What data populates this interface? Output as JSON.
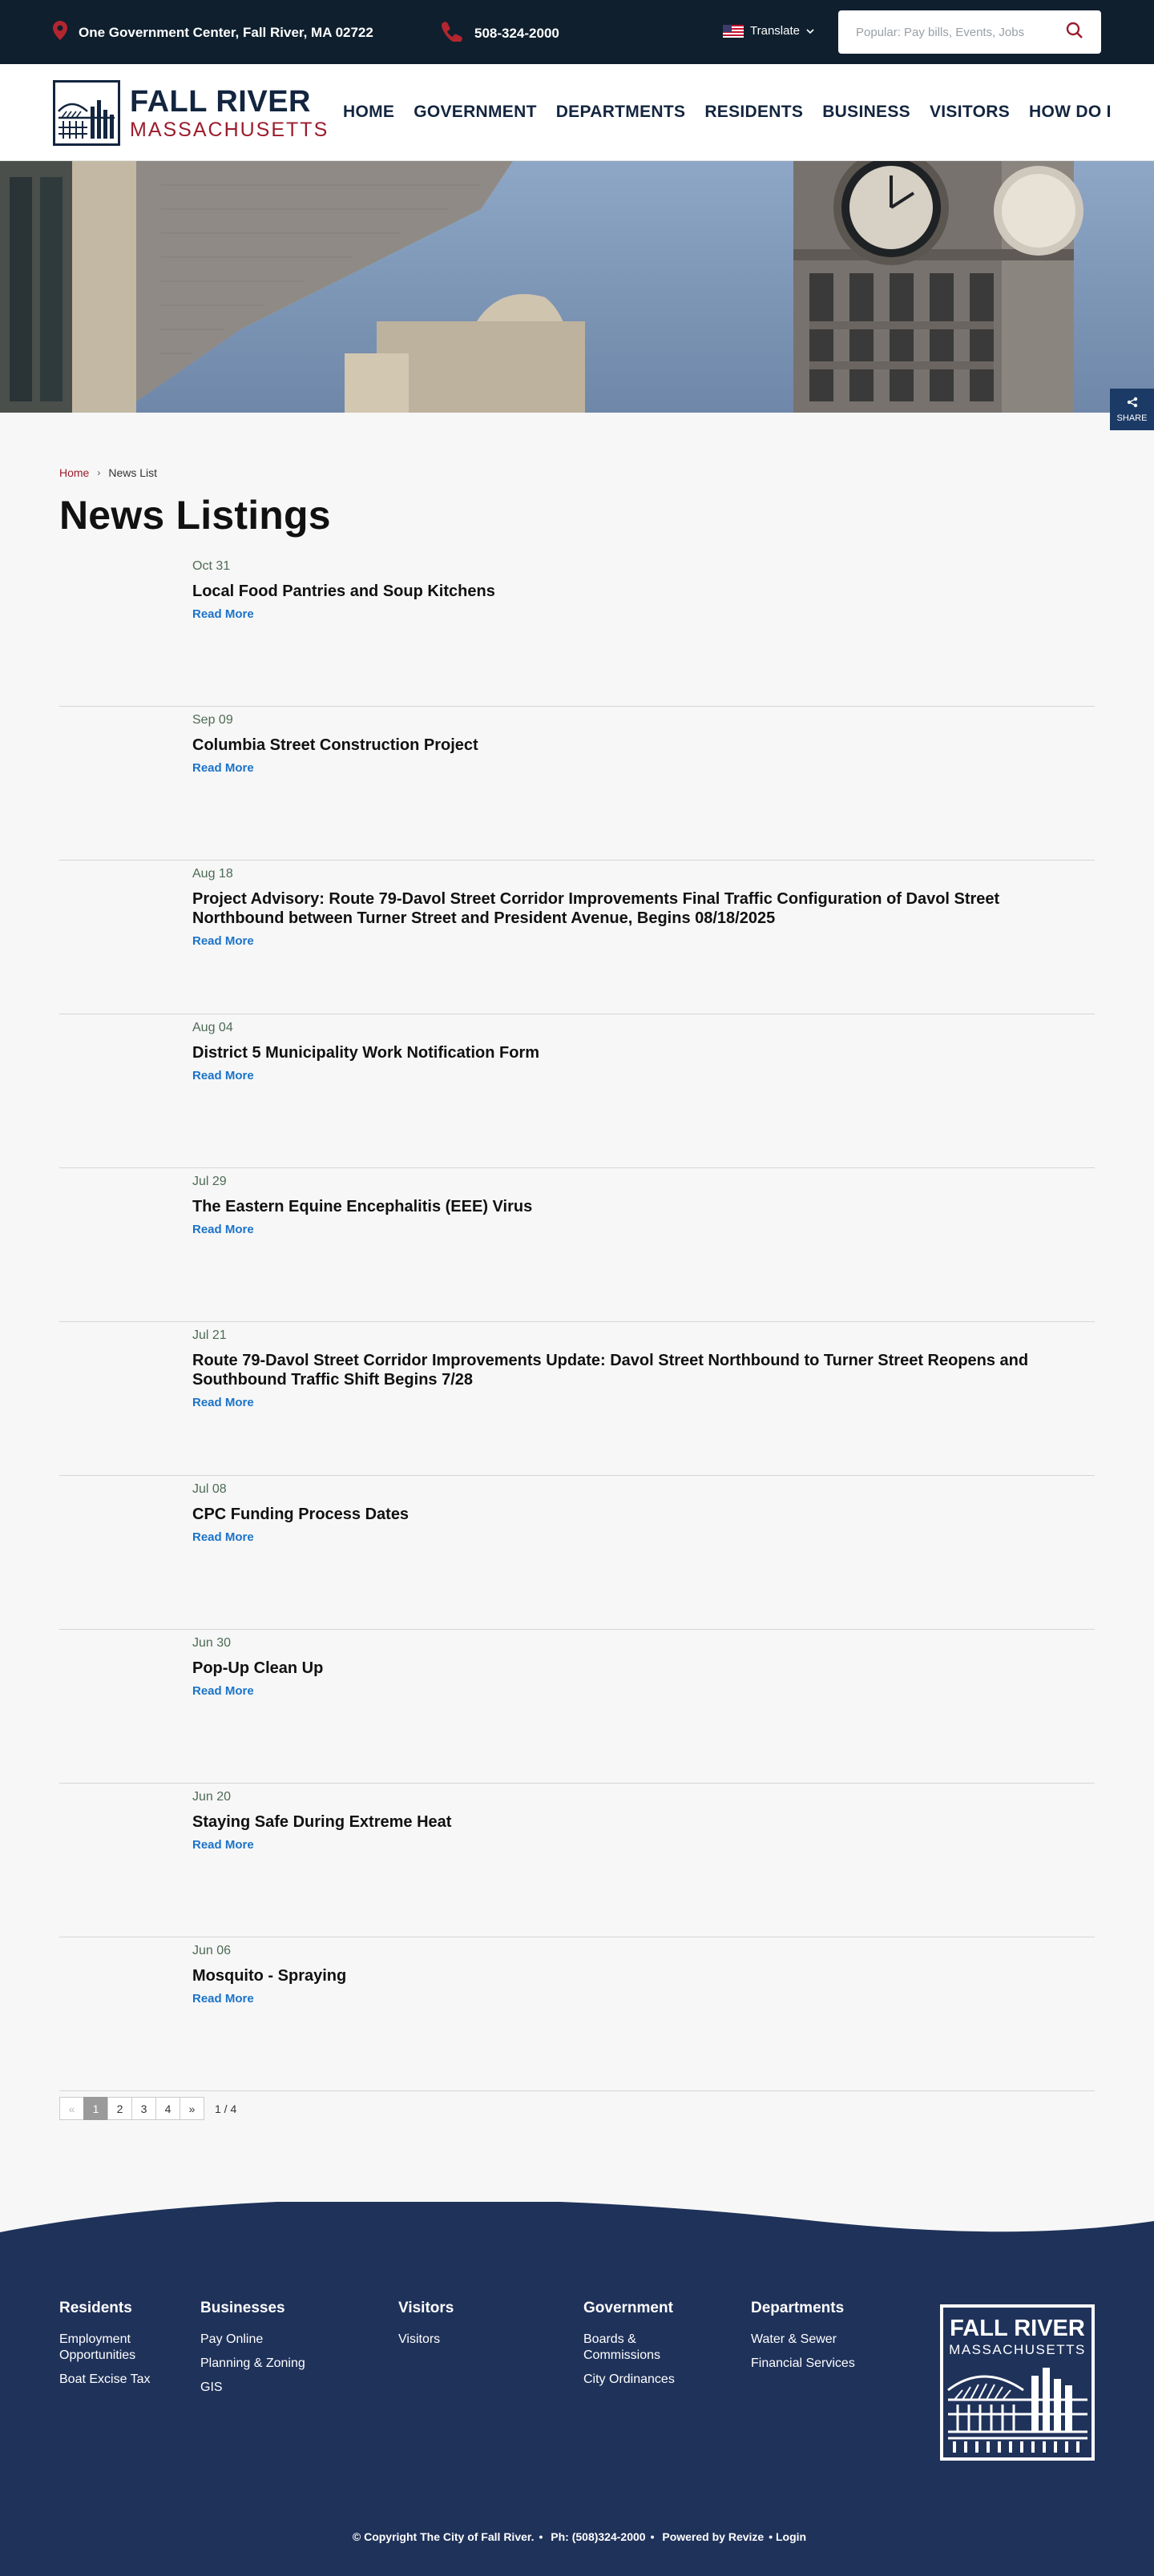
{
  "topbar": {
    "address": "One Government Center, Fall River, MA 02722",
    "phone": "508-324-2000",
    "translate_label": "Translate",
    "search_placeholder": "Popular: Pay bills, Events, Jobs"
  },
  "header": {
    "logo_line1": "FALL RIVER",
    "logo_line2": "MASSACHUSETTS",
    "nav": [
      "HOME",
      "GOVERNMENT",
      "DEPARTMENTS",
      "RESIDENTS",
      "BUSINESS",
      "VISITORS",
      "HOW DO I"
    ]
  },
  "share_label": "SHARE",
  "breadcrumb": {
    "home": "Home",
    "current": "News List"
  },
  "page_title": "News Listings",
  "news": [
    {
      "date": "Oct 31",
      "title": "Local Food Pantries and Soup Kitchens",
      "more": "Read More"
    },
    {
      "date": "Sep 09",
      "title": "Columbia Street Construction Project",
      "more": "Read More"
    },
    {
      "date": "Aug 18",
      "title": "Project Advisory: Route 79-Davol Street Corridor Improvements Final Traffic Configuration of Davol Street Northbound between Turner Street and President Avenue, Begins 08/18/2025",
      "more": "Read More"
    },
    {
      "date": "Aug 04",
      "title": "District 5 Municipality Work Notification Form",
      "more": "Read More"
    },
    {
      "date": "Jul 29",
      "title": "The Eastern Equine Encephalitis (EEE) Virus",
      "more": "Read More"
    },
    {
      "date": "Jul 21",
      "title": "Route 79-Davol Street Corridor Improvements Update: Davol Street Northbound to Turner Street Reopens and Southbound Traffic Shift Begins 7/28",
      "more": "Read More"
    },
    {
      "date": "Jul 08",
      "title": "CPC Funding Process Dates",
      "more": "Read More"
    },
    {
      "date": "Jun 30",
      "title": "Pop-Up Clean Up",
      "more": "Read More"
    },
    {
      "date": "Jun 20",
      "title": "Staying Safe During Extreme Heat",
      "more": "Read More"
    },
    {
      "date": "Jun 06",
      "title": "Mosquito - Spraying",
      "more": "Read More"
    }
  ],
  "pagination": {
    "prev": "«",
    "next": "»",
    "pages": [
      "1",
      "2",
      "3",
      "4"
    ],
    "current_page": 1,
    "count": "1 / 4"
  },
  "footer": {
    "columns": [
      {
        "heading": "Residents",
        "links": [
          "Employment Opportunities",
          "Boat Excise Tax"
        ]
      },
      {
        "heading": "Businesses",
        "links": [
          "Pay Online",
          "Planning & Zoning",
          "GIS"
        ]
      },
      {
        "heading": "Visitors",
        "links": [
          "Visitors"
        ]
      },
      {
        "heading": "Government",
        "links": [
          "Boards & Commissions",
          "City Ordinances"
        ]
      },
      {
        "heading": "Departments",
        "links": [
          "Water & Sewer",
          "Financial Services"
        ]
      }
    ],
    "logo_line1": "FALL RIVER",
    "logo_line2": "MASSACHUSETTS",
    "copyright": "© Copyright The City of Fall River.",
    "phone": "Ph: (508)324-2000",
    "powered": "Powered by Revize",
    "login": "Login"
  },
  "colors": {
    "topbar_bg": "#0f1f2e",
    "navy": "#13253f",
    "brand_red": "#9b1c2c",
    "link_blue": "#1a73c9",
    "footer_bg": "#1f325a"
  }
}
